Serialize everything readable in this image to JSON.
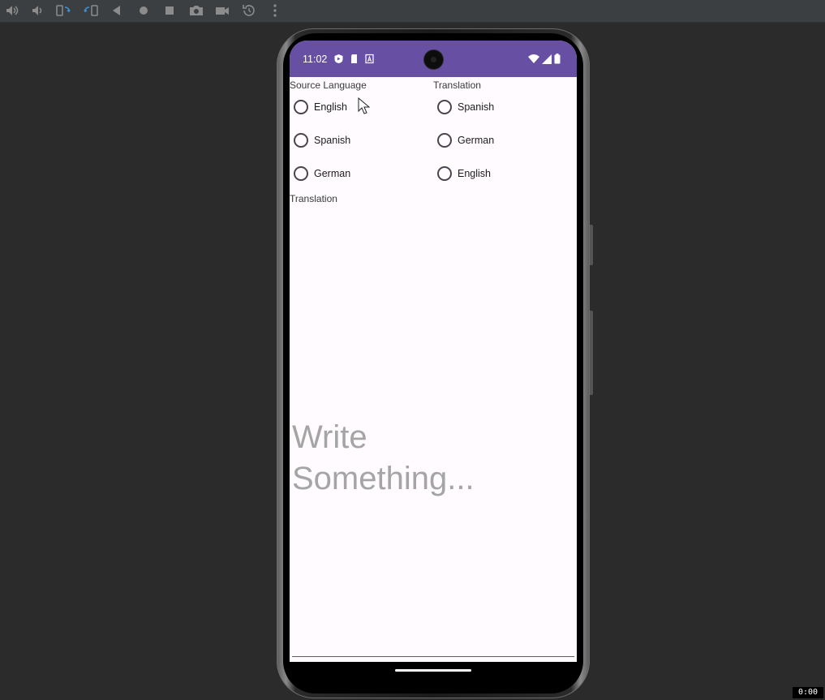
{
  "status_bar": {
    "time": "11:02"
  },
  "source": {
    "title": "Source Language",
    "options": [
      "English",
      "Spanish",
      "German"
    ]
  },
  "target": {
    "title": "Translation",
    "options": [
      "Spanish",
      "German",
      "English"
    ]
  },
  "result": {
    "label": "Translation"
  },
  "input": {
    "placeholder": "Write Something..."
  },
  "recorder": {
    "timer": "0:00"
  },
  "colors": {
    "status_bar": "#6750a4",
    "background": "#fffbfe",
    "placeholder": "#a5a5a5"
  }
}
